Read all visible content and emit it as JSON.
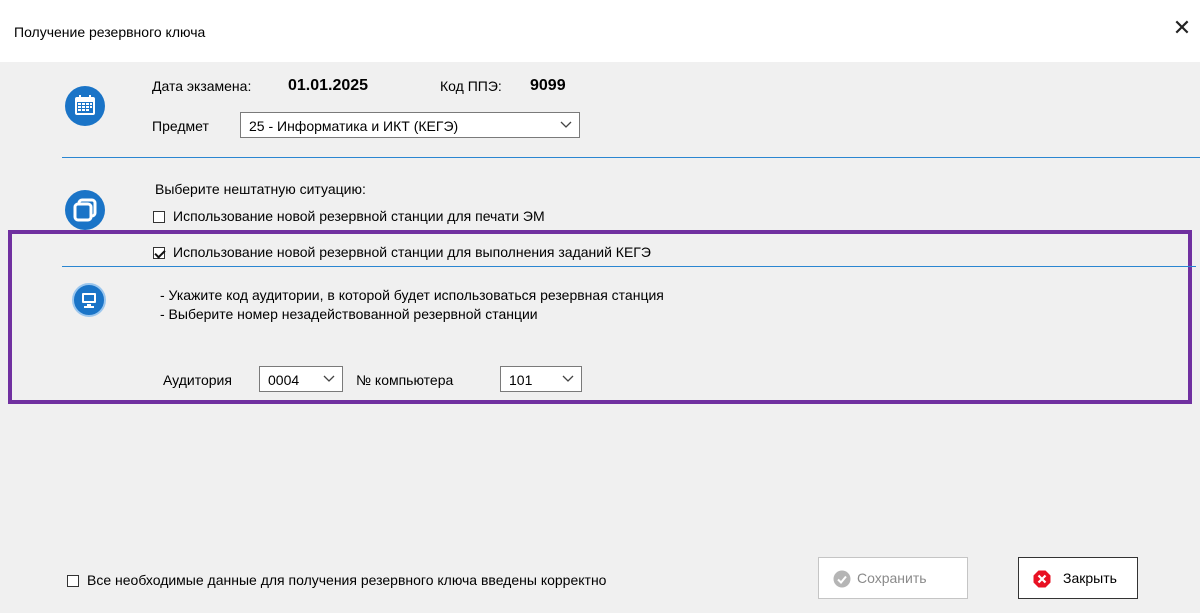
{
  "window": {
    "title": "Получение резервного ключа"
  },
  "exam": {
    "date_label": "Дата экзамена:",
    "date_value": "01.01.2025",
    "ppe_label": "Код ППЭ:",
    "ppe_value": "9099",
    "subject_label": "Предмет",
    "subject_value": "25 - Информатика и ИКТ (КЕГЭ)"
  },
  "situation": {
    "prompt": "Выберите нештатную ситуацию:",
    "option_print_label": "Использование новой резервной станции для печати ЭМ",
    "option_print_checked": false,
    "option_kege_label": "Использование новой резервной станции для выполнения заданий КЕГЭ",
    "option_kege_checked": true
  },
  "instructions": {
    "line1": "- Укажите код аудитории, в которой будет использоваться резервная станция",
    "line2": "- Выберите номер незадействованной резервной станции"
  },
  "station": {
    "auditorium_label": "Аудитория",
    "auditorium_value": "0004",
    "computer_label": "№ компьютера",
    "computer_value": "101"
  },
  "footer": {
    "confirm_label": "Все необходимые данные для получения резервного ключа введены корректно",
    "confirm_checked": false,
    "save_label": "Сохранить",
    "close_label": "Закрыть"
  },
  "colors": {
    "accent": "#1a74c7",
    "highlight_box": "#7030a0",
    "close_icon": "#e81123"
  },
  "icons": [
    "calendar-icon",
    "windows-stack-icon",
    "monitor-icon",
    "check-circle-icon",
    "error-x-icon",
    "chevron-down-icon",
    "close-icon"
  ]
}
